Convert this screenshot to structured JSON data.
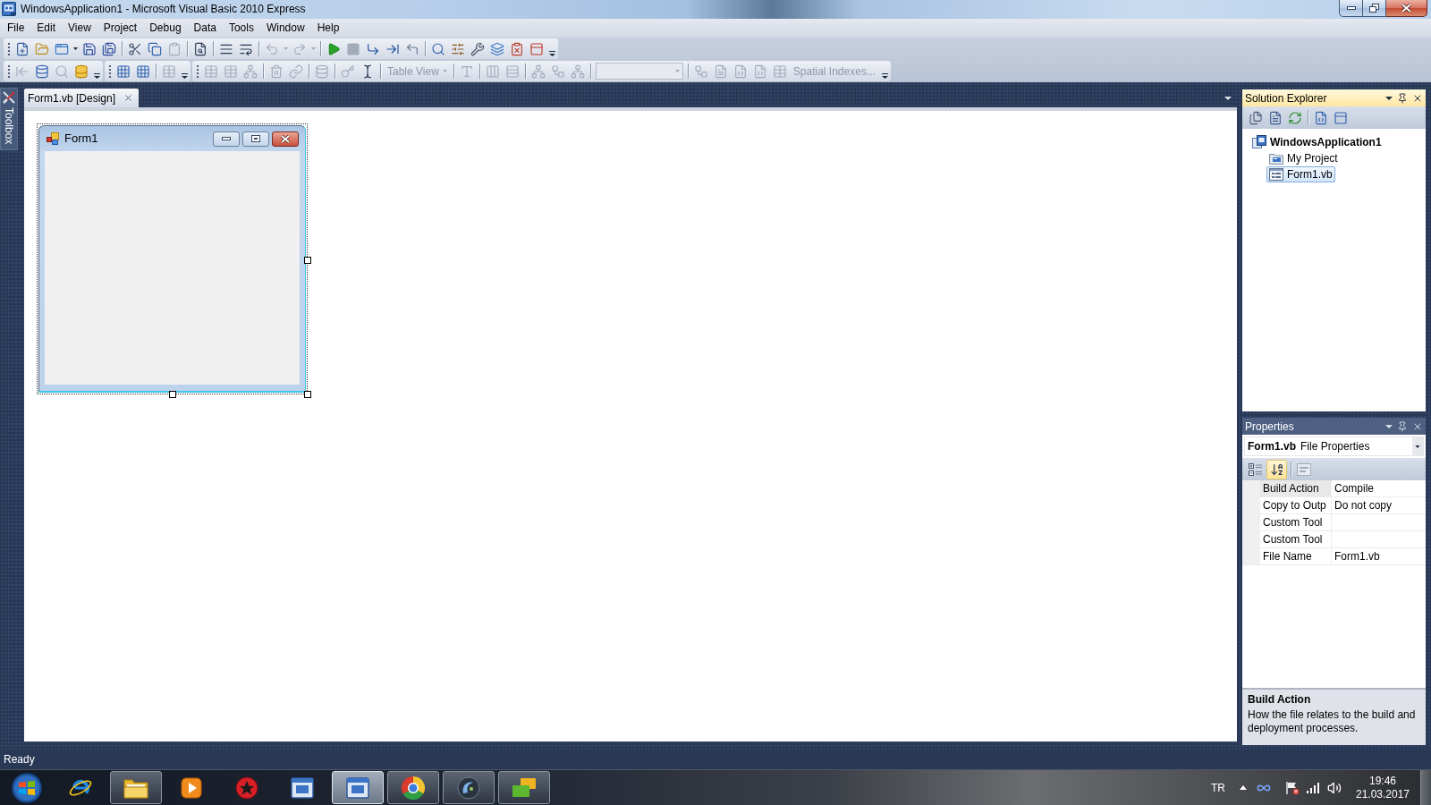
{
  "window": {
    "title": "WindowsApplication1 - Microsoft Visual Basic 2010 Express"
  },
  "menu_bar": [
    "File",
    "Edit",
    "View",
    "Project",
    "Debug",
    "Data",
    "Tools",
    "Window",
    "Help"
  ],
  "data_toolbar": {
    "table_view": {
      "label": "Table View",
      "disabled": true
    },
    "combo": {
      "disabled": true
    },
    "spatial_indexes": {
      "label": "Spatial Indexes...",
      "disabled": true
    }
  },
  "toolbox_tab": {
    "label": "Toolbox"
  },
  "document_tabs": [
    {
      "label": "Form1.vb [Design]",
      "selected": true
    }
  ],
  "designer": {
    "form": {
      "title": "Form1"
    }
  },
  "solution_explorer": {
    "title": "Solution Explorer",
    "active": true,
    "tree": [
      {
        "label": "WindowsApplication1",
        "kind": "project",
        "selected": false,
        "children": [
          {
            "label": "My Project",
            "kind": "my-project",
            "selected": false
          },
          {
            "label": "Form1.vb",
            "kind": "form",
            "selected": true
          }
        ]
      }
    ]
  },
  "properties": {
    "title": "Properties",
    "active": false,
    "object": {
      "name": "Form1.vb",
      "type": "File Properties"
    },
    "view_buttons": [
      {
        "kind": "categorized",
        "selected": false
      },
      {
        "kind": "alphabetical",
        "selected": true
      }
    ],
    "rows": [
      {
        "name": "Build Action",
        "value": "Compile",
        "selected": true
      },
      {
        "name": "Copy to Outp",
        "value": "Do not copy",
        "selected": false
      },
      {
        "name": "Custom Tool",
        "selected": false
      },
      {
        "name": "Custom Tool",
        "selected": false
      },
      {
        "name": "File Name",
        "value": "Form1.vb",
        "selected": false
      }
    ],
    "description": {
      "title": "Build Action",
      "text": "How the file relates to the build and deployment processes."
    }
  },
  "status_bar": {
    "text": "Ready"
  },
  "taskbar": {
    "apps": [
      {
        "kind": "e-logo",
        "running": false,
        "selected": false
      },
      {
        "kind": "folder",
        "running": true,
        "selected": false
      },
      {
        "kind": "media-player",
        "running": false,
        "selected": false
      },
      {
        "kind": "red-emblem",
        "running": false,
        "selected": false
      },
      {
        "kind": "vb",
        "running": false,
        "selected": false
      },
      {
        "kind": "vb",
        "running": true,
        "selected": true
      },
      {
        "kind": "round-logo",
        "running": true,
        "selected": false
      },
      {
        "kind": "swirl",
        "running": true,
        "selected": false
      },
      {
        "kind": "stacked-windows",
        "running": true,
        "selected": false
      }
    ],
    "tray": {
      "language": "TR",
      "time": "19:46",
      "date": "21.03.2017"
    }
  }
}
